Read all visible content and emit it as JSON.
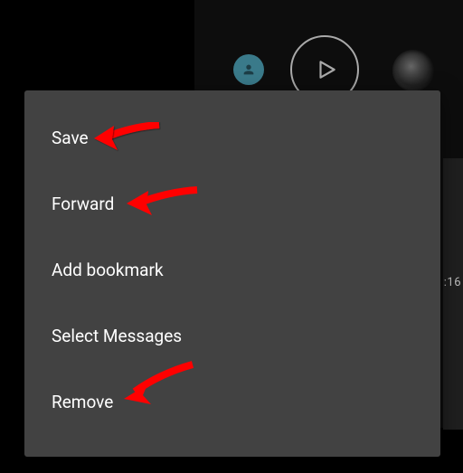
{
  "timestamp": ":16",
  "menu": {
    "items": [
      {
        "label": "Save"
      },
      {
        "label": "Forward"
      },
      {
        "label": "Add bookmark"
      },
      {
        "label": "Select Messages"
      },
      {
        "label": "Remove"
      }
    ]
  },
  "annotations": {
    "arrow_color": "#ff0000"
  }
}
